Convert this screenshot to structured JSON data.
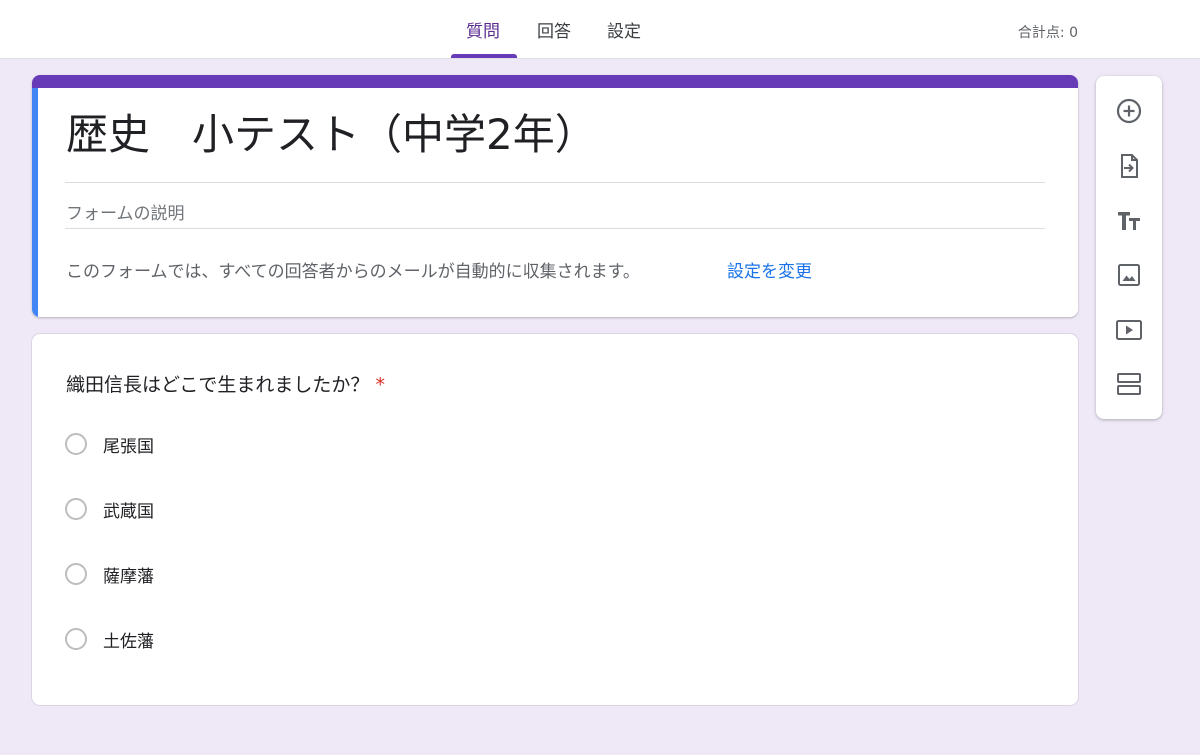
{
  "tabs": {
    "questions": "質問",
    "responses": "回答",
    "settings": "設定"
  },
  "total_points": "合計点: 0",
  "form": {
    "title": "歴史　小テスト（中学2年）",
    "description_placeholder": "フォームの説明",
    "email_notice": "このフォームでは、すべての回答者からのメールが自動的に収集されます。",
    "change_settings_link": "設定を変更"
  },
  "question": {
    "title": "織田信長はどこで生まれましたか？",
    "required_mark": "*",
    "options": [
      {
        "label": "尾張国"
      },
      {
        "label": "武蔵国"
      },
      {
        "label": "薩摩藩"
      },
      {
        "label": "土佐藩"
      }
    ]
  },
  "toolbar": {
    "icons": [
      "add-question-icon",
      "import-questions-icon",
      "add-title-icon",
      "add-image-icon",
      "add-video-icon",
      "add-section-icon"
    ]
  },
  "colors": {
    "accent": "#673ab7",
    "active_tab_text": "#5c2d91",
    "title_left_stripe": "#4285f4",
    "page_background": "#efe9f7",
    "link": "#1a73e8",
    "required": "#d93025"
  }
}
